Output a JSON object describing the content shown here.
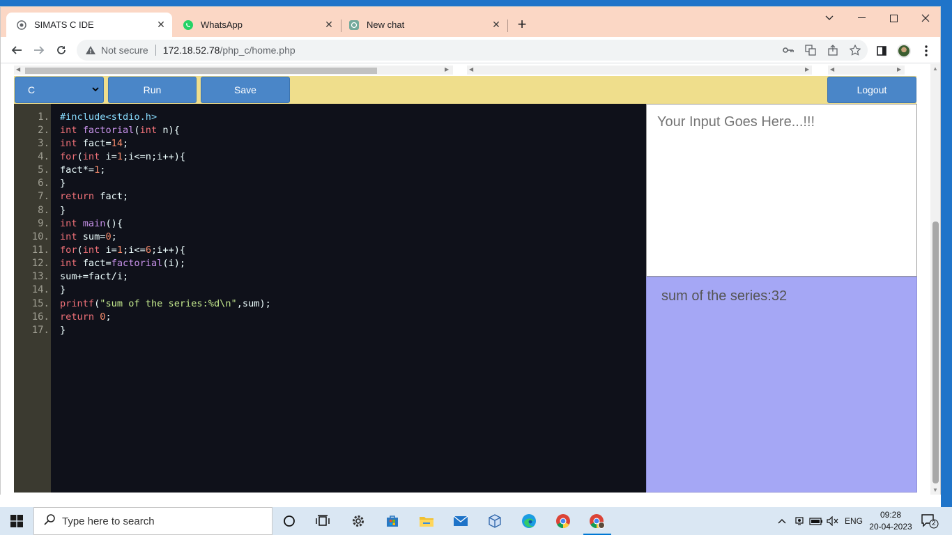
{
  "browser": {
    "tabs": [
      {
        "title": "SIMATS C IDE",
        "active": true,
        "icon": "globe-icon"
      },
      {
        "title": "WhatsApp",
        "active": false,
        "icon": "whatsapp-icon"
      },
      {
        "title": "New chat",
        "active": false,
        "icon": "openai-icon"
      }
    ],
    "new_tab": "+",
    "address": {
      "security_label": "Not secure",
      "url_host": "172.18.52.78",
      "url_path": "/php_c/home.php"
    }
  },
  "toolbar": {
    "language_selected": "C",
    "run_label": "Run",
    "save_label": "Save",
    "logout_label": "Logout"
  },
  "editor": {
    "line_numbers": [
      "1.",
      "2.",
      "3.",
      "4.",
      "5.",
      "6.",
      "7.",
      "8.",
      "9.",
      "10.",
      "11.",
      "12.",
      "13.",
      "14.",
      "15.",
      "16.",
      "17."
    ],
    "lines": [
      "#include<stdio.h>",
      "int factorial(int n){",
      "int fact=14;",
      "for(int i=1;i<=n;i++){",
      "fact*=1;",
      "}",
      "return fact;",
      "}",
      "int main(){",
      "int sum=0;",
      "for(int i=1;i<=6;i++){",
      "int fact=factorial(i);",
      "sum+=fact/i;",
      "}",
      "printf(\"sum of the series:%d\\n\",sum);",
      "return 0;",
      "}"
    ]
  },
  "input_panel": {
    "placeholder": "Your Input Goes Here...!!!"
  },
  "output_panel": {
    "text": "sum of the series:32"
  },
  "taskbar": {
    "search_placeholder": "Type here to search",
    "language": "ENG",
    "time": "09:28",
    "date": "20-04-2023",
    "notification_count": "2"
  },
  "colors": {
    "control_bar": "#efde8c",
    "button": "#4a86c8",
    "editor_bg": "#0f111a",
    "gutter_bg": "#3b3a30",
    "output_bg": "#a5a7f5",
    "tabbar": "#fbd7c5"
  }
}
